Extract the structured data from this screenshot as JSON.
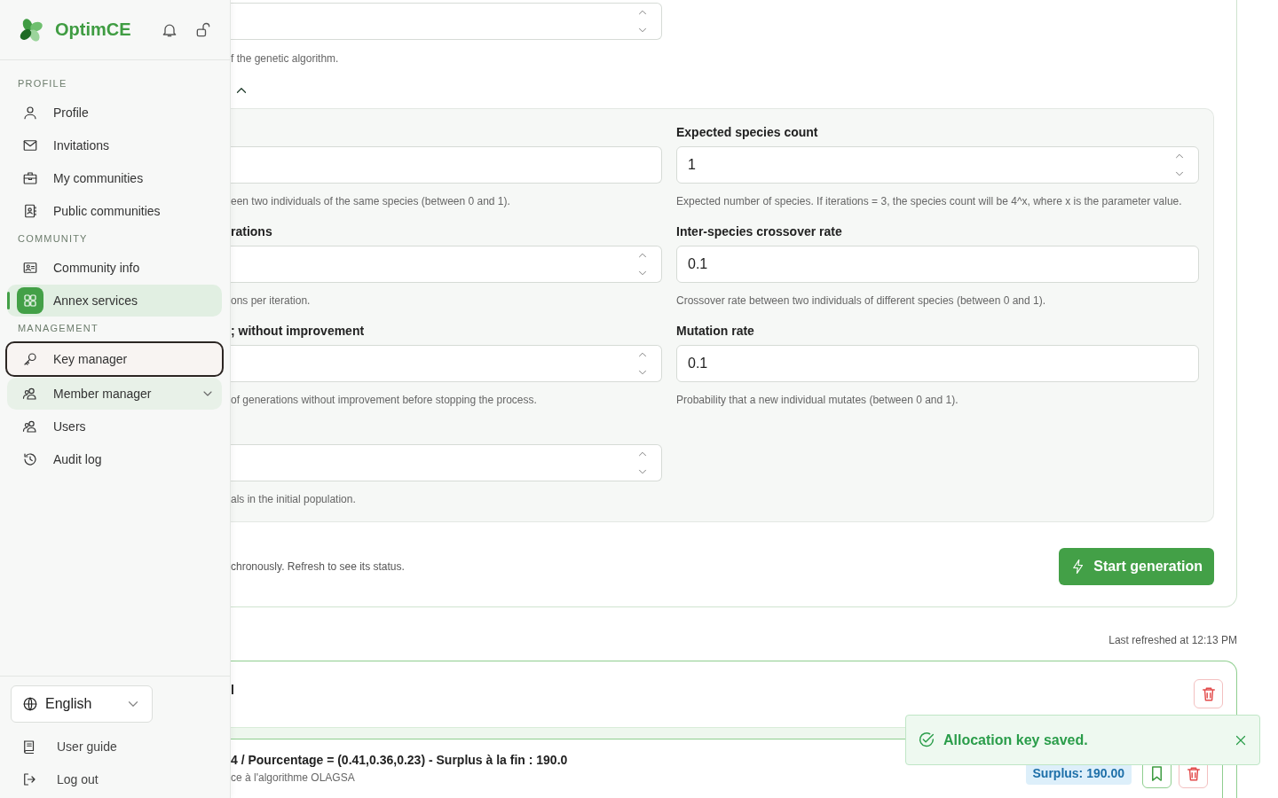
{
  "sidebar": {
    "brand": "OptimCE",
    "sections": [
      {
        "heading": "PROFILE",
        "items": [
          {
            "label": "Profile",
            "kind": "link",
            "selected": false,
            "focused": false
          },
          {
            "label": "Invitations",
            "kind": "link",
            "selected": false,
            "focused": false
          },
          {
            "label": "My communities",
            "kind": "link",
            "selected": false,
            "focused": false
          },
          {
            "label": "Public communities",
            "kind": "link",
            "selected": false,
            "focused": false
          }
        ]
      },
      {
        "heading": "COMMUNITY",
        "items": [
          {
            "label": "Community info",
            "kind": "link",
            "selected": false,
            "focused": false
          },
          {
            "label": "Annex services",
            "kind": "link",
            "selected": true,
            "focused": false
          }
        ]
      },
      {
        "heading": "MANAGEMENT",
        "items": [
          {
            "label": "Key manager",
            "kind": "link",
            "selected": false,
            "focused": true
          },
          {
            "label": "Member manager",
            "kind": "group",
            "expanded": false,
            "selected": false,
            "focused": false
          },
          {
            "label": "Users",
            "kind": "link",
            "selected": false,
            "focused": false
          },
          {
            "label": "Audit log",
            "kind": "link",
            "selected": false,
            "focused": false
          }
        ]
      }
    ],
    "language": {
      "value": "English"
    },
    "footer_links": [
      "User guide",
      "Log out"
    ]
  },
  "main": {
    "top_field": {
      "spinner": true,
      "help": "f the genetic algorithm."
    },
    "advanced": {
      "expanded": true,
      "left_fields": [
        {
          "spinner": false,
          "help": "een two individuals of the same species (between 0 and 1)."
        },
        {
          "label": "rations",
          "spinner": true,
          "help": "ons per iteration."
        },
        {
          "label": "; without improvement",
          "spinner": true,
          "help": "of generations without improvement before stopping the process."
        },
        {
          "spinner": true,
          "help": "als in the initial population."
        }
      ],
      "right_fields": [
        {
          "label": "Expected species count",
          "value": "1",
          "spinner": true,
          "help": "Expected number of species. If iterations = 3, the species count will be 4^x, where x is the parameter value."
        },
        {
          "label": "Inter-species crossover rate",
          "value": "0.1",
          "spinner": false,
          "help": "Crossover rate between two individuals of different species (between 0 and 1)."
        },
        {
          "label": "Mutation rate",
          "value": "0.1",
          "spinner": false,
          "help": "Probability that a new individual mutates (between 0 and 1)."
        }
      ]
    },
    "run_note": "chronously. Refresh to see its status.",
    "start_button": "Start generation",
    "last_refreshed": "Last refreshed at 12:13 PM",
    "result_card": {
      "title": "l",
      "runs": [
        {
          "title": "4 / Pourcentage = (0.41,0.36,0.23) - Surplus à la fin : 190.0",
          "subtitle": "ce à l'algorithme OLAGSA",
          "badge": "Surplus: 190.00"
        }
      ]
    }
  },
  "toast": {
    "message": "Allocation key saved."
  }
}
